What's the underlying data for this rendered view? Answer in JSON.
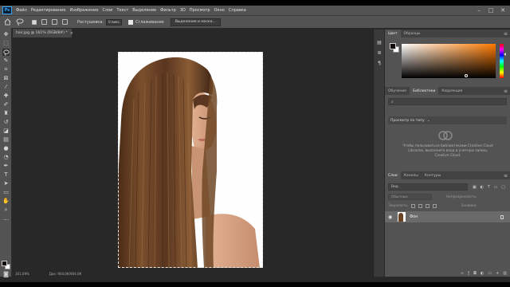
{
  "menu": {
    "logo": "Ps",
    "items": [
      "Файл",
      "Редактирование",
      "Изображение",
      "Слои",
      "Текст",
      "Выделение",
      "Фильтр",
      "3D",
      "Просмотр",
      "Окно",
      "Справка"
    ]
  },
  "window_controls": {
    "minimize": "–",
    "maximize": "□",
    "close": "✕"
  },
  "options": {
    "feather_label": "Растушевка:",
    "feather_value": "0 пикс.",
    "antialias_label": "Сглаживание",
    "select_mask_button": "Выделение и маска..."
  },
  "document": {
    "tab_title": "hair.jpg @ 161% (RGB/8#) *",
    "close_glyph": "×"
  },
  "status": {
    "zoom": "161,09%",
    "doc_size": "Док: 904,0К/904,0К"
  },
  "colors": {
    "foreground": "#120d0b",
    "background": "#ffffff",
    "picker_hue": "#ff7a00"
  },
  "color_panel": {
    "tabs": [
      "Цвет",
      "Образцы"
    ]
  },
  "library_panel": {
    "tabs": [
      "Обучение",
      "Библиотеки",
      "Коррекция"
    ],
    "active_tab": 1,
    "search_placeholder": "",
    "sort_label": "Просмотр по типу",
    "sort_value": "⌄",
    "message": "Чтобы пользоваться библиотеками Creative Cloud Libraries, выполните вход в учетную запись Creative Cloud."
  },
  "layers_panel": {
    "tabs": [
      "Слои",
      "Каналы",
      "Контуры"
    ],
    "active_tab": 0,
    "filter_label": "Вид",
    "blend_mode": "Обычные",
    "opacity_label": "Непрозрачность:",
    "lock_label": "Закрепить:",
    "fill_label": "Заливка:",
    "layer_name": "Фон"
  },
  "panel_menu_glyph": "≡"
}
